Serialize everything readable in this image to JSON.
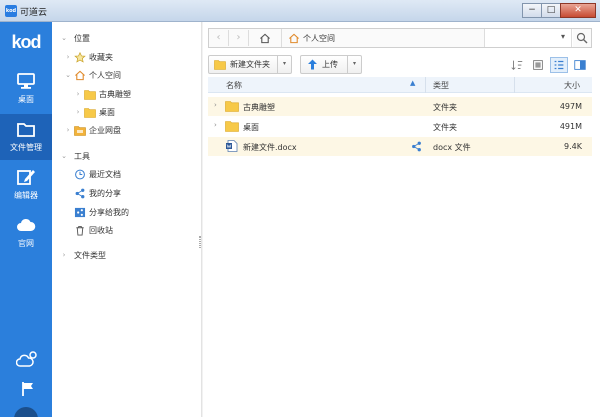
{
  "window": {
    "title": "可道云",
    "app_icon_label": "kod",
    "buttons": {
      "minimize": "−",
      "maximize": "□",
      "close": "✕"
    }
  },
  "rail": {
    "logo": "kod",
    "items": [
      {
        "label": "桌面",
        "icon": "monitor-icon"
      },
      {
        "label": "文件管理",
        "icon": "folder-icon",
        "active": true
      },
      {
        "label": "编辑器",
        "icon": "edit-icon"
      },
      {
        "label": "官网",
        "icon": "cloud-icon"
      }
    ],
    "bottom_icons": [
      "cloud-settings-icon",
      "flag-icon"
    ]
  },
  "tree": {
    "location_header": "位置",
    "favorites": "收藏夹",
    "personal_space": "个人空间",
    "personal_children": [
      "古典雕塑",
      "桌面"
    ],
    "enterprise_disk": "企业网盘",
    "tools_header": "工具",
    "tools": [
      "最近文档",
      "我的分享",
      "分享给我的",
      "回收站"
    ],
    "file_types": "文件类型"
  },
  "address": {
    "back": "‹",
    "forward": "›",
    "home_icon": "home-icon",
    "current": "个人空间",
    "search_placeholder": "",
    "dropdown": "▾"
  },
  "toolbar": {
    "new_folder": "新建文件夹",
    "upload": "上传",
    "dd": "▾"
  },
  "table": {
    "columns": {
      "name": "名称",
      "type": "类型",
      "size": "大小"
    },
    "sort_arrow": "▲",
    "rows": [
      {
        "name": "古典雕塑",
        "type": "文件夹",
        "size": "497M",
        "kind": "folder",
        "expandable": true,
        "highlight": true
      },
      {
        "name": "桌面",
        "type": "文件夹",
        "size": "491M",
        "kind": "folder",
        "expandable": true,
        "highlight": false
      },
      {
        "name": "新建文件.docx",
        "type": "docx 文件",
        "size": "9.4K",
        "kind": "docx",
        "expandable": false,
        "highlight": true,
        "shared": true
      }
    ]
  },
  "colors": {
    "accent": "#2b7fdc",
    "rail_active": "#1e63b8",
    "folder": "#f7c948",
    "row_highlight": "#fdf7e5"
  }
}
